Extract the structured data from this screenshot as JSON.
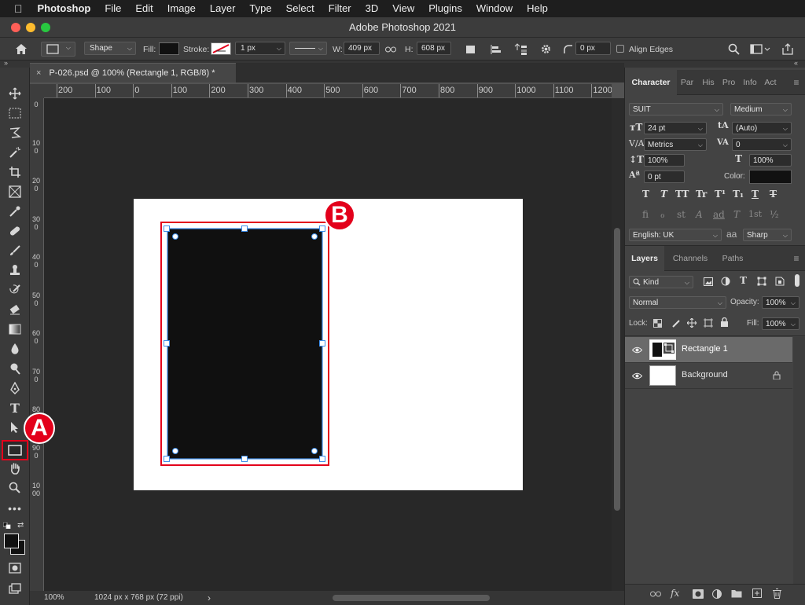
{
  "menubar": {
    "apple_icon": "apple-logo-icon",
    "items": [
      "Photoshop",
      "File",
      "Edit",
      "Image",
      "Layer",
      "Type",
      "Select",
      "Filter",
      "3D",
      "View",
      "Plugins",
      "Window",
      "Help"
    ]
  },
  "window": {
    "title": "Adobe Photoshop 2021"
  },
  "options": {
    "mode": "Shape",
    "fill_label": "Fill:",
    "stroke_label": "Stroke:",
    "stroke_width": "1 px",
    "w_label": "W:",
    "w_value": "409 px",
    "h_label": "H:",
    "h_value": "608 px",
    "radius_value": "0 px",
    "align_edges": "Align Edges",
    "fill_color": "#111111"
  },
  "document": {
    "tab_title": "P-026.psd @ 100% (Rectangle 1, RGB/8) *",
    "close_icon": "×"
  },
  "ruler": {
    "h_ticks": [
      "200",
      "100",
      "0",
      "100",
      "200",
      "300",
      "400",
      "500",
      "600",
      "700",
      "800",
      "900",
      "1000",
      "1100",
      "1200"
    ],
    "v_ticks": [
      "0",
      "100",
      "200",
      "300",
      "400",
      "500",
      "600",
      "700",
      "800",
      "900",
      "1000"
    ]
  },
  "status": {
    "zoom": "100%",
    "doc_info": "1024 px x 768 px (72 ppi)",
    "arrow": "›"
  },
  "character_panel": {
    "tabs": [
      "Character",
      "Par",
      "His",
      "Pro",
      "Info",
      "Act"
    ],
    "font_family": "SUIT",
    "font_style": "Medium",
    "font_size": "24 pt",
    "leading": "(Auto)",
    "kerning": "Metrics",
    "tracking": "0",
    "vertical_scale": "100%",
    "horizontal_scale": "100%",
    "baseline_shift": "0 pt",
    "color_label": "Color:",
    "language": "English: UK",
    "aa_label": "aa",
    "antialias": "Sharp",
    "style_glyphs": [
      "T",
      "T",
      "TT",
      "Tr",
      "T¹",
      "T₁",
      "T",
      "T"
    ],
    "opentype_glyphs": [
      "fi",
      "ℴ",
      "st",
      "A",
      "ad",
      "T",
      "1st",
      "½"
    ]
  },
  "layers_panel": {
    "tabs": [
      "Layers",
      "Channels",
      "Paths"
    ],
    "filter": "Kind",
    "blend_mode": "Normal",
    "opacity_label": "Opacity:",
    "opacity": "100%",
    "lock_label": "Lock:",
    "fill_label": "Fill:",
    "fill": "100%",
    "layers": [
      {
        "name": "Rectangle 1",
        "selected": true
      },
      {
        "name": "Background",
        "selected": false
      }
    ]
  },
  "callouts": {
    "a": "A",
    "b": "B"
  },
  "colors": {
    "accent_red": "#e3001b",
    "selection_blue": "#3f8ee8"
  }
}
